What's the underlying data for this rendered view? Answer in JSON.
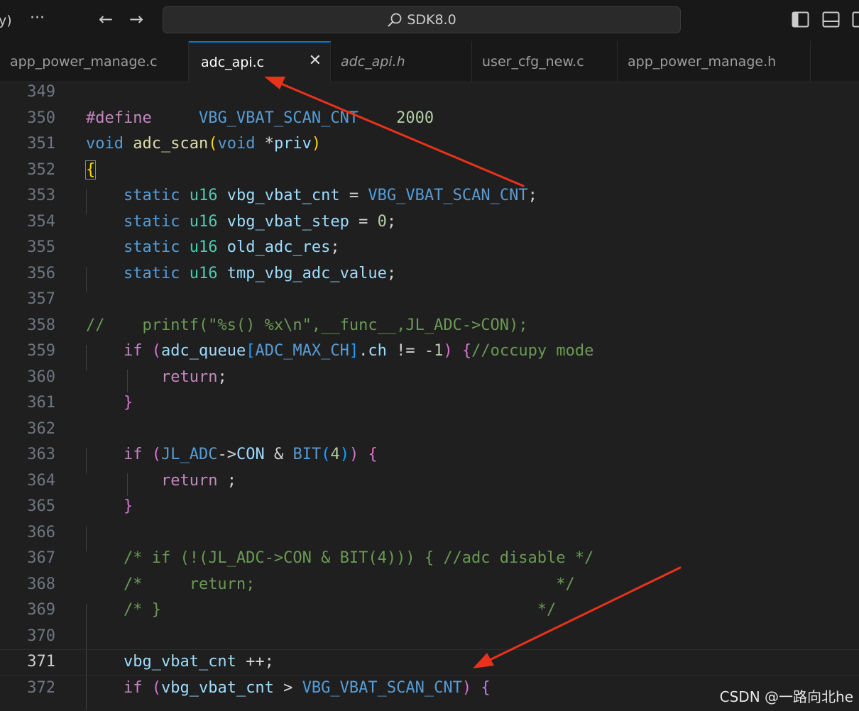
{
  "titlebar": {
    "left_fragment": "y)",
    "more_glyph": "···",
    "back_glyph": "←",
    "forward_glyph": "→",
    "search_label": "SDK8.0"
  },
  "tabs": [
    {
      "label": "app_power_manage.c",
      "active": false,
      "preview": false
    },
    {
      "label": "adc_api.c",
      "active": true,
      "preview": false
    },
    {
      "label": "adc_api.h",
      "active": false,
      "preview": true
    },
    {
      "label": "user_cfg_new.c",
      "active": false,
      "preview": false
    },
    {
      "label": "app_power_manage.h",
      "active": false,
      "preview": false
    }
  ],
  "tab_close_glyph": "✕",
  "editor": {
    "current_line": "371",
    "lines": [
      {
        "num": "349"
      },
      {
        "num": "350",
        "tokens": [
          {
            "t": "#define",
            "c": "ctl"
          },
          {
            "t": "     "
          },
          {
            "t": "VBG_VBAT_SCAN_CNT",
            "c": "mac"
          },
          {
            "t": "    "
          },
          {
            "t": "2000",
            "c": "num"
          }
        ]
      },
      {
        "num": "351",
        "tokens": [
          {
            "t": "void",
            "c": "kw"
          },
          {
            "t": " "
          },
          {
            "t": "adc_scan",
            "c": "fn"
          },
          {
            "t": "(",
            "c": "b1"
          },
          {
            "t": "void",
            "c": "kw"
          },
          {
            "t": " *",
            "c": "pl"
          },
          {
            "t": "priv",
            "c": "id"
          },
          {
            "t": ")",
            "c": "b1"
          }
        ]
      },
      {
        "num": "352",
        "tokens": [
          {
            "t": "{",
            "c": "b1",
            "hl": true
          }
        ]
      },
      {
        "num": "353",
        "tokens": [
          {
            "t": "    "
          },
          {
            "t": "static",
            "c": "kw"
          },
          {
            "t": " "
          },
          {
            "t": "u16",
            "c": "ty"
          },
          {
            "t": " "
          },
          {
            "t": "vbg_vbat_cnt",
            "c": "id"
          },
          {
            "t": " = ",
            "c": "pl"
          },
          {
            "t": "VBG_VBAT_SCAN_CNT",
            "c": "mac"
          },
          {
            "t": ";",
            "c": "pl"
          }
        ]
      },
      {
        "num": "354",
        "tokens": [
          {
            "t": "    "
          },
          {
            "t": "static",
            "c": "kw"
          },
          {
            "t": " "
          },
          {
            "t": "u16",
            "c": "ty"
          },
          {
            "t": " "
          },
          {
            "t": "vbg_vbat_step",
            "c": "id"
          },
          {
            "t": " = ",
            "c": "pl"
          },
          {
            "t": "0",
            "c": "num"
          },
          {
            "t": ";",
            "c": "pl"
          }
        ]
      },
      {
        "num": "355",
        "tokens": [
          {
            "t": "    "
          },
          {
            "t": "static",
            "c": "kw"
          },
          {
            "t": " "
          },
          {
            "t": "u16",
            "c": "ty"
          },
          {
            "t": " "
          },
          {
            "t": "old_adc_res",
            "c": "id"
          },
          {
            "t": ";",
            "c": "pl"
          }
        ]
      },
      {
        "num": "356",
        "tokens": [
          {
            "t": "    "
          },
          {
            "t": "static",
            "c": "kw"
          },
          {
            "t": " "
          },
          {
            "t": "u16",
            "c": "ty"
          },
          {
            "t": " "
          },
          {
            "t": "tmp_vbg_adc_value",
            "c": "id"
          },
          {
            "t": ";",
            "c": "pl"
          }
        ]
      },
      {
        "num": "357"
      },
      {
        "num": "358",
        "tokens": [
          {
            "t": "//    printf(\"%s() %x\\n\",__func__,JL_ADC->CON);",
            "c": "cm"
          }
        ]
      },
      {
        "num": "359",
        "tokens": [
          {
            "t": "    "
          },
          {
            "t": "if",
            "c": "ctl"
          },
          {
            "t": " "
          },
          {
            "t": "(",
            "c": "b2"
          },
          {
            "t": "adc_queue",
            "c": "id"
          },
          {
            "t": "[",
            "c": "b3"
          },
          {
            "t": "ADC_MAX_CH",
            "c": "mac"
          },
          {
            "t": "]",
            "c": "b3"
          },
          {
            "t": ".",
            "c": "pl"
          },
          {
            "t": "ch",
            "c": "id"
          },
          {
            "t": " != ",
            "c": "pl"
          },
          {
            "t": "-1",
            "c": "num"
          },
          {
            "t": ")",
            "c": "b2"
          },
          {
            "t": " "
          },
          {
            "t": "{",
            "c": "b2"
          },
          {
            "t": "//occupy mode",
            "c": "cm"
          }
        ]
      },
      {
        "num": "360",
        "tokens": [
          {
            "t": "        "
          },
          {
            "t": "return",
            "c": "ctl"
          },
          {
            "t": ";",
            "c": "pl"
          }
        ]
      },
      {
        "num": "361",
        "tokens": [
          {
            "t": "    "
          },
          {
            "t": "}",
            "c": "b2"
          }
        ]
      },
      {
        "num": "362"
      },
      {
        "num": "363",
        "tokens": [
          {
            "t": "    "
          },
          {
            "t": "if",
            "c": "ctl"
          },
          {
            "t": " "
          },
          {
            "t": "(",
            "c": "b2"
          },
          {
            "t": "JL_ADC",
            "c": "mac"
          },
          {
            "t": "->",
            "c": "pl"
          },
          {
            "t": "CON",
            "c": "id"
          },
          {
            "t": " & ",
            "c": "pl"
          },
          {
            "t": "BIT",
            "c": "mac"
          },
          {
            "t": "(",
            "c": "b3"
          },
          {
            "t": "4",
            "c": "num"
          },
          {
            "t": ")",
            "c": "b3"
          },
          {
            "t": ")",
            "c": "b2"
          },
          {
            "t": " "
          },
          {
            "t": "{",
            "c": "b2"
          }
        ]
      },
      {
        "num": "364",
        "tokens": [
          {
            "t": "        "
          },
          {
            "t": "return",
            "c": "ctl"
          },
          {
            "t": " ;",
            "c": "pl"
          }
        ]
      },
      {
        "num": "365",
        "tokens": [
          {
            "t": "    "
          },
          {
            "t": "}",
            "c": "b2"
          }
        ]
      },
      {
        "num": "366"
      },
      {
        "num": "367",
        "tokens": [
          {
            "t": "    "
          },
          {
            "t": "/* if (!(JL_ADC->CON & BIT(4))) { //adc disable */",
            "c": "cm"
          }
        ]
      },
      {
        "num": "368",
        "tokens": [
          {
            "t": "    "
          },
          {
            "t": "/*     return;                                */",
            "c": "cm"
          }
        ]
      },
      {
        "num": "369",
        "tokens": [
          {
            "t": "    "
          },
          {
            "t": "/* }                                        */",
            "c": "cm"
          }
        ]
      },
      {
        "num": "370"
      },
      {
        "num": "371",
        "tokens": [
          {
            "t": "    "
          },
          {
            "t": "vbg_vbat_cnt",
            "c": "id"
          },
          {
            "t": " ++;",
            "c": "pl"
          }
        ]
      },
      {
        "num": "372",
        "tokens": [
          {
            "t": "    "
          },
          {
            "t": "if",
            "c": "ctl"
          },
          {
            "t": " "
          },
          {
            "t": "(",
            "c": "b2"
          },
          {
            "t": "vbg_vbat_cnt",
            "c": "id"
          },
          {
            "t": " > ",
            "c": "pl"
          },
          {
            "t": "VBG_VBAT_SCAN_CNT",
            "c": "mac"
          },
          {
            "t": ")",
            "c": "b2"
          },
          {
            "t": " "
          },
          {
            "t": "{",
            "c": "b2"
          }
        ]
      }
    ]
  },
  "annotation_color": "#e8321c",
  "watermark": "CSDN @一路向北he"
}
